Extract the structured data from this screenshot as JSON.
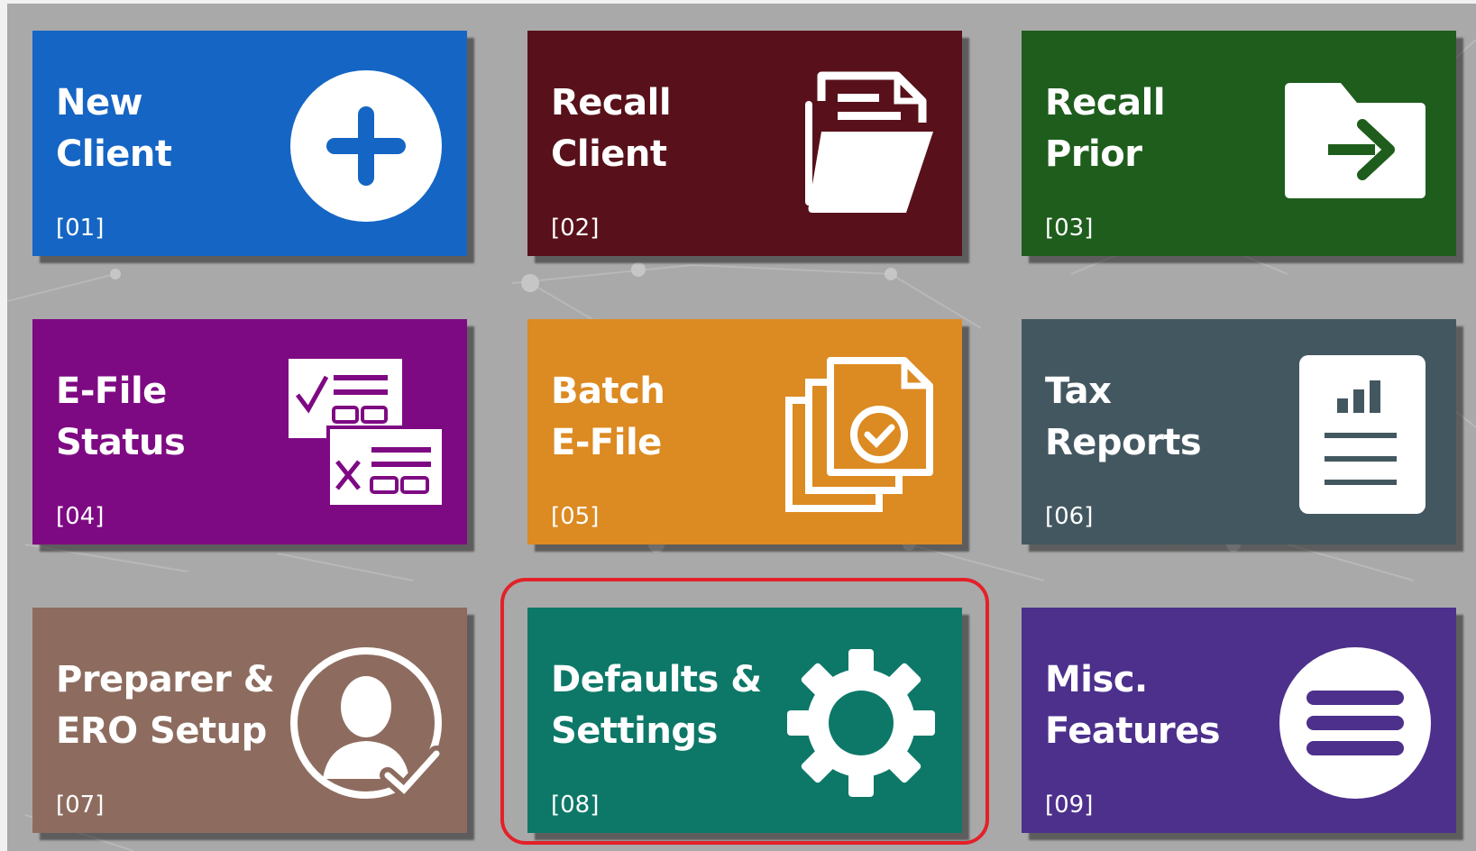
{
  "tiles": [
    {
      "line1": "New",
      "line2": "Client",
      "code": "[01]",
      "icon": "plus-circle-icon",
      "color": "#1565c4"
    },
    {
      "line1": "Recall",
      "line2": "Client",
      "code": "[02]",
      "icon": "open-folder-document-icon",
      "color": "#58111a"
    },
    {
      "line1": "Recall",
      "line2": "Prior",
      "code": "[03]",
      "icon": "folder-arrow-icon",
      "color": "#1e5d1c"
    },
    {
      "line1": "E-File",
      "line2": "Status",
      "code": "[04]",
      "icon": "checklist-forms-icon",
      "color": "#7e0a83"
    },
    {
      "line1": "Batch",
      "line2": "E-File",
      "code": "[05]",
      "icon": "stacked-documents-check-icon",
      "color": "#dc8a22"
    },
    {
      "line1": "Tax",
      "line2": "Reports",
      "code": "[06]",
      "icon": "report-chart-icon",
      "color": "#435760"
    },
    {
      "line1": "Preparer &",
      "line2": "ERO Setup",
      "code": "[07]",
      "icon": "user-check-icon",
      "color": "#8d6c5f"
    },
    {
      "line1": "Defaults &",
      "line2": "Settings",
      "code": "[08]",
      "icon": "gear-icon",
      "color": "#0d7868"
    },
    {
      "line1": "Misc.",
      "line2": "Features",
      "code": "[09]",
      "icon": "hamburger-menu-icon",
      "color": "#4c308c"
    }
  ],
  "highlight": {
    "target": "Defaults & Settings",
    "color": "#e32128"
  }
}
